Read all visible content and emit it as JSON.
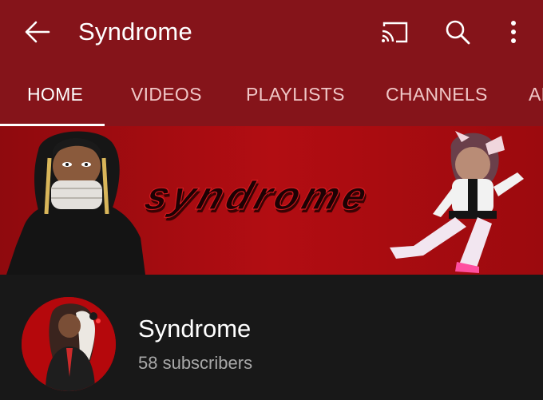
{
  "appbar": {
    "title": "Syndrome",
    "icons": [
      "back-arrow-icon",
      "cast-icon",
      "search-icon",
      "more-vertical-icon"
    ]
  },
  "tabs": [
    {
      "label": "HOME",
      "active": true
    },
    {
      "label": "VIDEOS",
      "active": false
    },
    {
      "label": "PLAYLISTS",
      "active": false
    },
    {
      "label": "CHANNELS",
      "active": false
    },
    {
      "label": "ABOUT",
      "active": false
    }
  ],
  "banner": {
    "logo_text": "syndrome"
  },
  "channel": {
    "name": "Syndrome",
    "subscribers": "58 subscribers"
  },
  "colors": {
    "appbar_bg": "#85141a",
    "banner_bg": "#a50b10",
    "page_bg": "#181818",
    "tab_inactive": "#f0c7c7",
    "subtext": "#a8a8a8"
  }
}
